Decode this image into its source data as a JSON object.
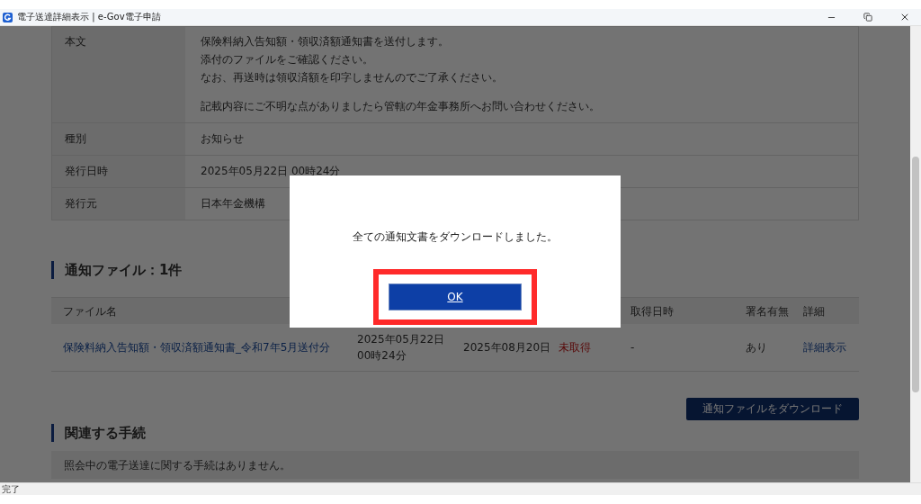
{
  "window": {
    "title": "電子送達詳細表示 | e-Gov電子申請"
  },
  "details": [
    {
      "label": "本文",
      "paragraphs": [
        [
          "保険料納入告知額・領収済額通知書を送付します。",
          "添付のファイルをご確認ください。",
          "なお、再送時は領収済額を印字しませんのでご了承ください。"
        ],
        [
          "記載内容にご不明な点がありましたら管轄の年金事務所へお問い合わせください。"
        ]
      ]
    },
    {
      "label": "種別",
      "paragraphs": [
        [
          "お知らせ"
        ]
      ]
    },
    {
      "label": "発行日時",
      "paragraphs": [
        [
          "2025年05月22日 00時24分"
        ]
      ]
    },
    {
      "label": "発行元",
      "paragraphs": [
        [
          "日本年金機構"
        ]
      ]
    }
  ],
  "files": {
    "heading": "通知ファイル：1件",
    "columns": [
      {
        "label": "ファイル名"
      },
      {},
      {},
      {},
      {
        "label": "取得日時"
      },
      {
        "label": "署名有無"
      },
      {
        "label": "詳細"
      }
    ],
    "rows": [
      {
        "cells": [
          {
            "kind": "link",
            "lines": [
              "保険料納入告知額・領収済額通知書_令和7年5月送付分"
            ]
          },
          {
            "kind": "text",
            "lines": [
              "2025年05月22日",
              "00時24分"
            ]
          },
          {
            "kind": "text",
            "lines": [
              "2025年08月20日"
            ]
          },
          {
            "kind": "alert",
            "lines": [
              "未取得"
            ]
          },
          {
            "kind": "text",
            "lines": [
              "-"
            ]
          },
          {
            "kind": "text",
            "lines": [
              "あり"
            ]
          },
          {
            "kind": "link",
            "lines": [
              "詳細表示"
            ]
          }
        ]
      }
    ],
    "download_button": "通知ファイルをダウンロード"
  },
  "related": {
    "heading": "関連する手続",
    "message": "照会中の電子送達に関する手続はありません。"
  },
  "dialog": {
    "message": "全ての通知文書をダウンロードしました。",
    "button": "OK"
  },
  "status_bar": "完了"
}
